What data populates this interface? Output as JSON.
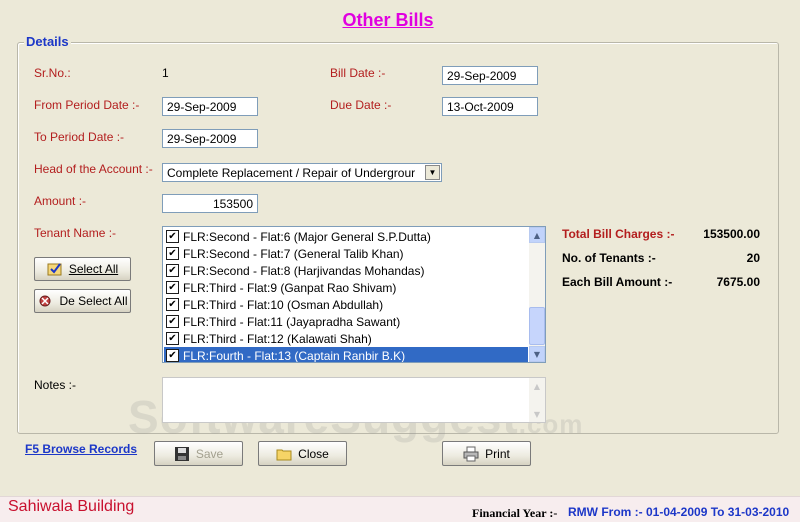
{
  "title": "Other Bills",
  "details_legend": "Details",
  "form": {
    "srno_label": "Sr.No.:",
    "srno_value": "1",
    "bill_date_label": "Bill Date :-",
    "bill_date_value": "29-Sep-2009",
    "from_period_label": "From Period Date :-",
    "from_period_value": "29-Sep-2009",
    "due_date_label": "Due Date :-",
    "due_date_value": "13-Oct-2009",
    "to_period_label": "To Period Date :-",
    "to_period_value": "29-Sep-2009",
    "head_account_label": "Head of the Account :-",
    "head_account_value": "Complete Replacement / Repair of Undergrour",
    "amount_label": "Amount :-",
    "amount_value": "153500",
    "tenant_label": "Tenant Name :-",
    "notes_label": "Notes :-",
    "notes_value": ""
  },
  "buttons": {
    "select_all": "Select All",
    "de_select_all": "De Select All",
    "save": "Save",
    "close": "Close",
    "print": "Print"
  },
  "tenants": [
    {
      "label": "FLR:Second - Flat:6 (Major General S.P.Dutta)",
      "checked": true,
      "selected": false
    },
    {
      "label": "FLR:Second - Flat:7 (General Talib Khan)",
      "checked": true,
      "selected": false
    },
    {
      "label": "FLR:Second - Flat:8 (Harjivandas Mohandas)",
      "checked": true,
      "selected": false
    },
    {
      "label": "FLR:Third - Flat:9 (Ganpat Rao Shivam)",
      "checked": true,
      "selected": false
    },
    {
      "label": "FLR:Third - Flat:10 (Osman Abdullah)",
      "checked": true,
      "selected": false
    },
    {
      "label": "FLR:Third - Flat:11 (Jayapradha Sawant)",
      "checked": true,
      "selected": false
    },
    {
      "label": "FLR:Third - Flat:12 (Kalawati Shah)",
      "checked": true,
      "selected": false
    },
    {
      "label": "FLR:Fourth - Flat:13 (Captain Ranbir B.K)",
      "checked": true,
      "selected": true
    }
  ],
  "summary": {
    "total_label": "Total Bill Charges :-",
    "total_value": "153500.00",
    "tenants_label": "No. of Tenants :-",
    "tenants_value": "20",
    "each_label": "Each Bill Amount :-",
    "each_value": "7675.00"
  },
  "browse_records": "F5 Browse Records",
  "footer": {
    "building": "Sahiwala Building",
    "fy_label": "Financial Year :-",
    "fy_value": "RMW From :- 01-04-2009 To 31-03-2010"
  },
  "watermark": {
    "main": "SoftwareSuggest",
    "suffix": ".com"
  },
  "colors": {
    "title": "#E000E0",
    "label": "#B31E1E",
    "legend": "#1C37C8",
    "selection": "#316AC5",
    "background": "#ECE9D8"
  },
  "icons": {
    "select_all": "check-icon",
    "de_select_all": "uncheck-icon",
    "save": "floppy-disk-icon",
    "close": "folder-icon",
    "print": "printer-icon"
  }
}
